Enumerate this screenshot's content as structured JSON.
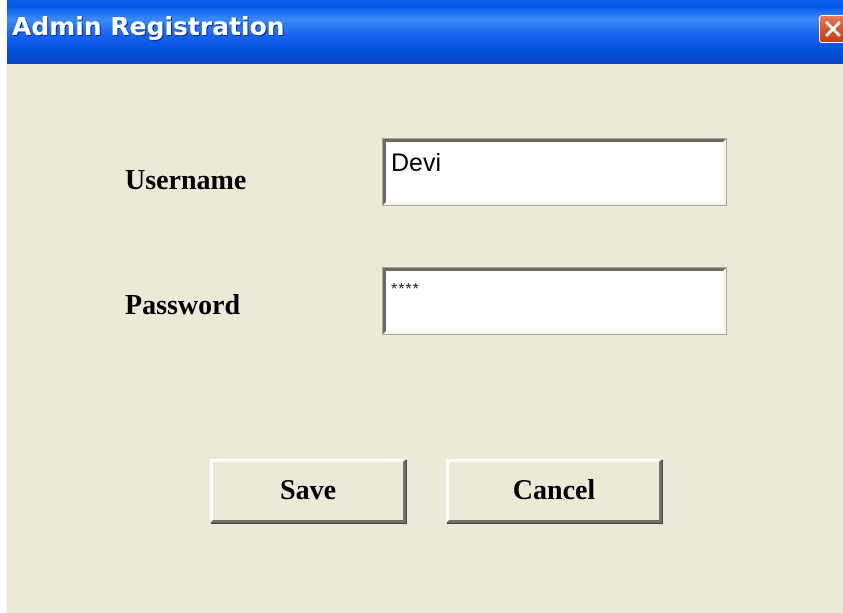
{
  "window": {
    "title": "Admin Registration",
    "close_icon": "close-icon",
    "colors": {
      "titlebar": "#0a5fe6",
      "background": "#ece9d8",
      "close_button": "#d9532c"
    }
  },
  "form": {
    "username": {
      "label": "Username",
      "value": "Devi"
    },
    "password": {
      "label": "Password",
      "value": "****"
    }
  },
  "buttons": {
    "save_label": "Save",
    "cancel_label": "Cancel"
  }
}
